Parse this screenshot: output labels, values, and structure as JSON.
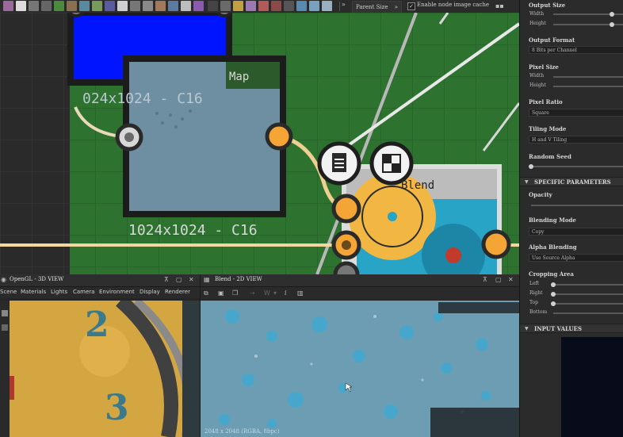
{
  "toolbar": {
    "parent_size_label": "Parent Size",
    "parent_size_arrow": "»",
    "left_arrow": "»",
    "cache_checkbox": "✓",
    "cache_label": "Enable node image cache",
    "end_icon": "▪▪"
  },
  "graph": {
    "node_map": {
      "title": "Map",
      "top_resolution": "024x1024 - C16",
      "resolution": "1024x1024 - C16"
    },
    "node_blend": {
      "title": "Blend"
    },
    "colors": {
      "canvas": "#2e7230",
      "node_blue": "#0014ff",
      "port_orange": "#f4a536"
    }
  },
  "viewport_3d": {
    "title": "OpenGL - 3D VIEW",
    "menu": [
      "Scene",
      "Materials",
      "Lights",
      "Camera",
      "Environment",
      "Display",
      "Renderer"
    ],
    "numerals": [
      "2",
      "3"
    ]
  },
  "viewport_2d": {
    "title": "Blend - 2D VIEW",
    "resolution_text": "2048 x 2048 (RGBA, 8bpc)",
    "tool_italic": "i"
  },
  "properties": {
    "output_size": {
      "label": "Output Size",
      "width_label": "Width",
      "height_label": "Height"
    },
    "output_format": {
      "label": "Output Format",
      "value": "8 Bits per Channel"
    },
    "pixel_size": {
      "label": "Pixel Size",
      "width_label": "Width",
      "height_label": "Height"
    },
    "pixel_ratio": {
      "label": "Pixel Ratio",
      "value": "Square"
    },
    "tiling_mode": {
      "label": "Tiling Mode",
      "value": "H and V Tiling"
    },
    "random_seed": {
      "label": "Random Seed"
    },
    "specific_section": "SPECIFIC PARAMETERS",
    "opacity": {
      "label": "Opacity"
    },
    "blending_mode": {
      "label": "Blending Mode",
      "value": "Copy"
    },
    "alpha_blending": {
      "label": "Alpha Blending",
      "value": "Use Source Alpha"
    },
    "cropping_area": {
      "label": "Cropping Area",
      "left": "Left",
      "right": "Right",
      "top": "Top",
      "bottom": "Bottom"
    },
    "input_section": "INPUT VALUES"
  }
}
